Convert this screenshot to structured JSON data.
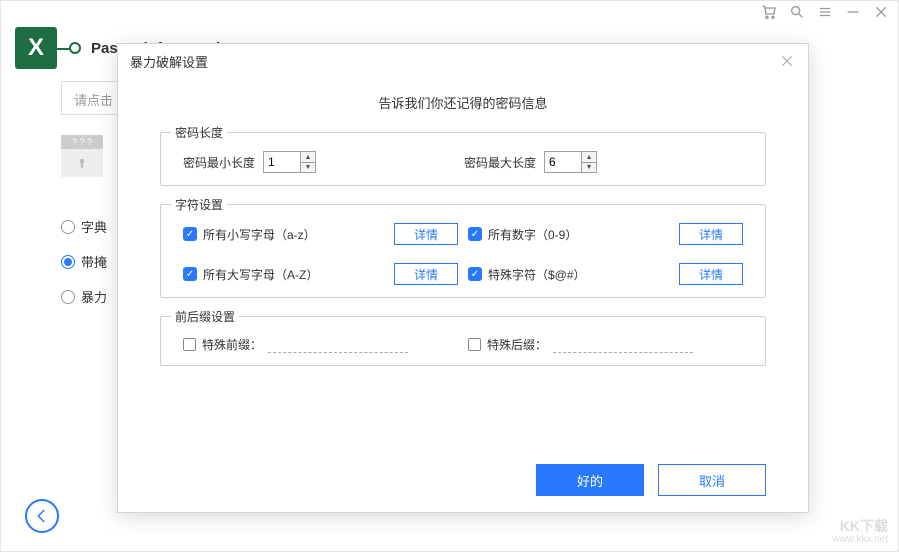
{
  "topbar": {
    "cart": "cart",
    "search": "search",
    "menu": "menu",
    "minimize": "minimize",
    "close": "close"
  },
  "app": {
    "title": "PassFab for Excel"
  },
  "background": {
    "input_placeholder": "请点击",
    "file_box_top": "? ? ?",
    "radio_items": [
      "字典",
      "带掩",
      "暴力"
    ],
    "radio_selected_index": 1
  },
  "modal": {
    "title": "暴力破解设置",
    "prompt": "告诉我们你还记得的密码信息",
    "password_length": {
      "legend": "密码长度",
      "min_label": "密码最小长度",
      "min_value": "1",
      "max_label": "密码最大长度",
      "max_value": "6"
    },
    "charset": {
      "legend": "字符设置",
      "detail_label": "详情",
      "items": [
        {
          "label": "所有小写字母（a-z）",
          "checked": true
        },
        {
          "label": "所有数字（0-9）",
          "checked": true
        },
        {
          "label": "所有大写字母（A-Z）",
          "checked": true
        },
        {
          "label": "特殊字符（$@#）",
          "checked": true
        }
      ]
    },
    "affix": {
      "legend": "前后缀设置",
      "prefix_label": "特殊前缀：",
      "prefix_value": "",
      "suffix_label": "特殊后缀：",
      "suffix_value": ""
    },
    "footer": {
      "ok": "好的",
      "cancel": "取消"
    }
  },
  "watermark": {
    "line1": "KK下载",
    "line2": "www.kkx.net"
  }
}
